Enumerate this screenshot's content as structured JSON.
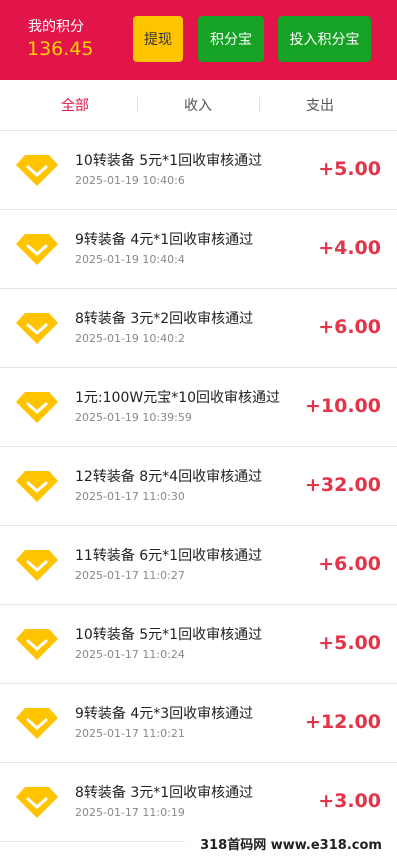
{
  "header": {
    "points_label": "我的积分",
    "points_value": "136.45",
    "withdraw_label": "提现",
    "bank_label": "积分宝",
    "invest_label": "投入积分宝"
  },
  "tabs": [
    {
      "label": "全部"
    },
    {
      "label": "收入"
    },
    {
      "label": "支出"
    }
  ],
  "records": [
    {
      "title": "10转装备 5元*1回收审核通过",
      "time": "2025-01-19 10:40:6",
      "amount": "+5.00"
    },
    {
      "title": "9转装备 4元*1回收审核通过",
      "time": "2025-01-19 10:40:4",
      "amount": "+4.00"
    },
    {
      "title": "8转装备 3元*2回收审核通过",
      "time": "2025-01-19 10:40:2",
      "amount": "+6.00"
    },
    {
      "title": "1元:100W元宝*10回收审核通过",
      "time": "2025-01-19 10:39:59",
      "amount": "+10.00"
    },
    {
      "title": "12转装备 8元*4回收审核通过",
      "time": "2025-01-17 11:0:30",
      "amount": "+32.00"
    },
    {
      "title": "11转装备 6元*1回收审核通过",
      "time": "2025-01-17 11:0:27",
      "amount": "+6.00"
    },
    {
      "title": "10转装备 5元*1回收审核通过",
      "time": "2025-01-17 11:0:24",
      "amount": "+5.00"
    },
    {
      "title": "9转装备 4元*3回收审核通过",
      "time": "2025-01-17 11:0:21",
      "amount": "+12.00"
    },
    {
      "title": "8转装备 3元*1回收审核通过",
      "time": "2025-01-17 11:0:19",
      "amount": "+3.00"
    }
  ],
  "watermark": "318首码网 www.e318.com",
  "colors": {
    "header_bg": "#e3144a",
    "points_value": "#ffd400",
    "withdraw_bg": "#ffc400",
    "action_green": "#16a325",
    "active_tab": "#e3144a",
    "amount": "#e3344a",
    "gem_icon": "#ffc400"
  },
  "icons": {
    "record_icon": "diamond-icon"
  }
}
